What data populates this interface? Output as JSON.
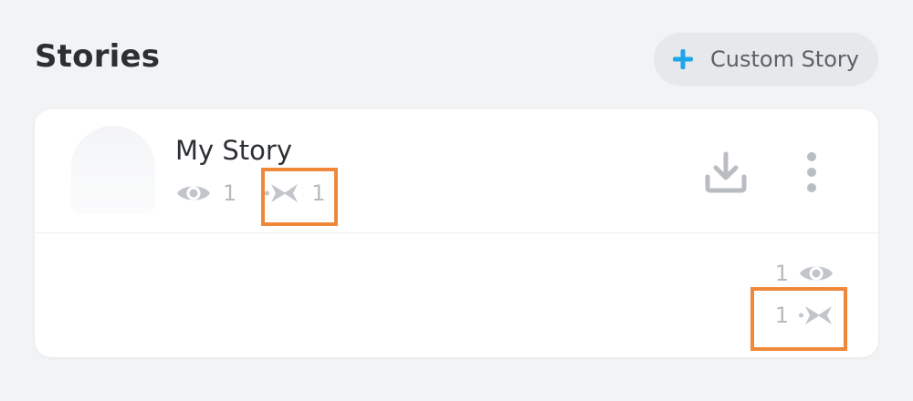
{
  "header": {
    "title": "Stories",
    "custom_story_label": "Custom Story",
    "plus_icon": "plus-icon"
  },
  "story": {
    "title": "My Story",
    "views": "1",
    "screenshots": "1",
    "views_icon": "eye-icon",
    "screenshots_icon": "screenshot-arrows-icon",
    "download_icon": "download-icon",
    "more_icon": "more-vertical-icon"
  },
  "snap": {
    "views": "1",
    "screenshots": "1"
  },
  "colors": {
    "accent": "#1ea7e8",
    "highlight": "#f0883a",
    "muted": "#b7bbc0",
    "title": "#2c2f33"
  }
}
